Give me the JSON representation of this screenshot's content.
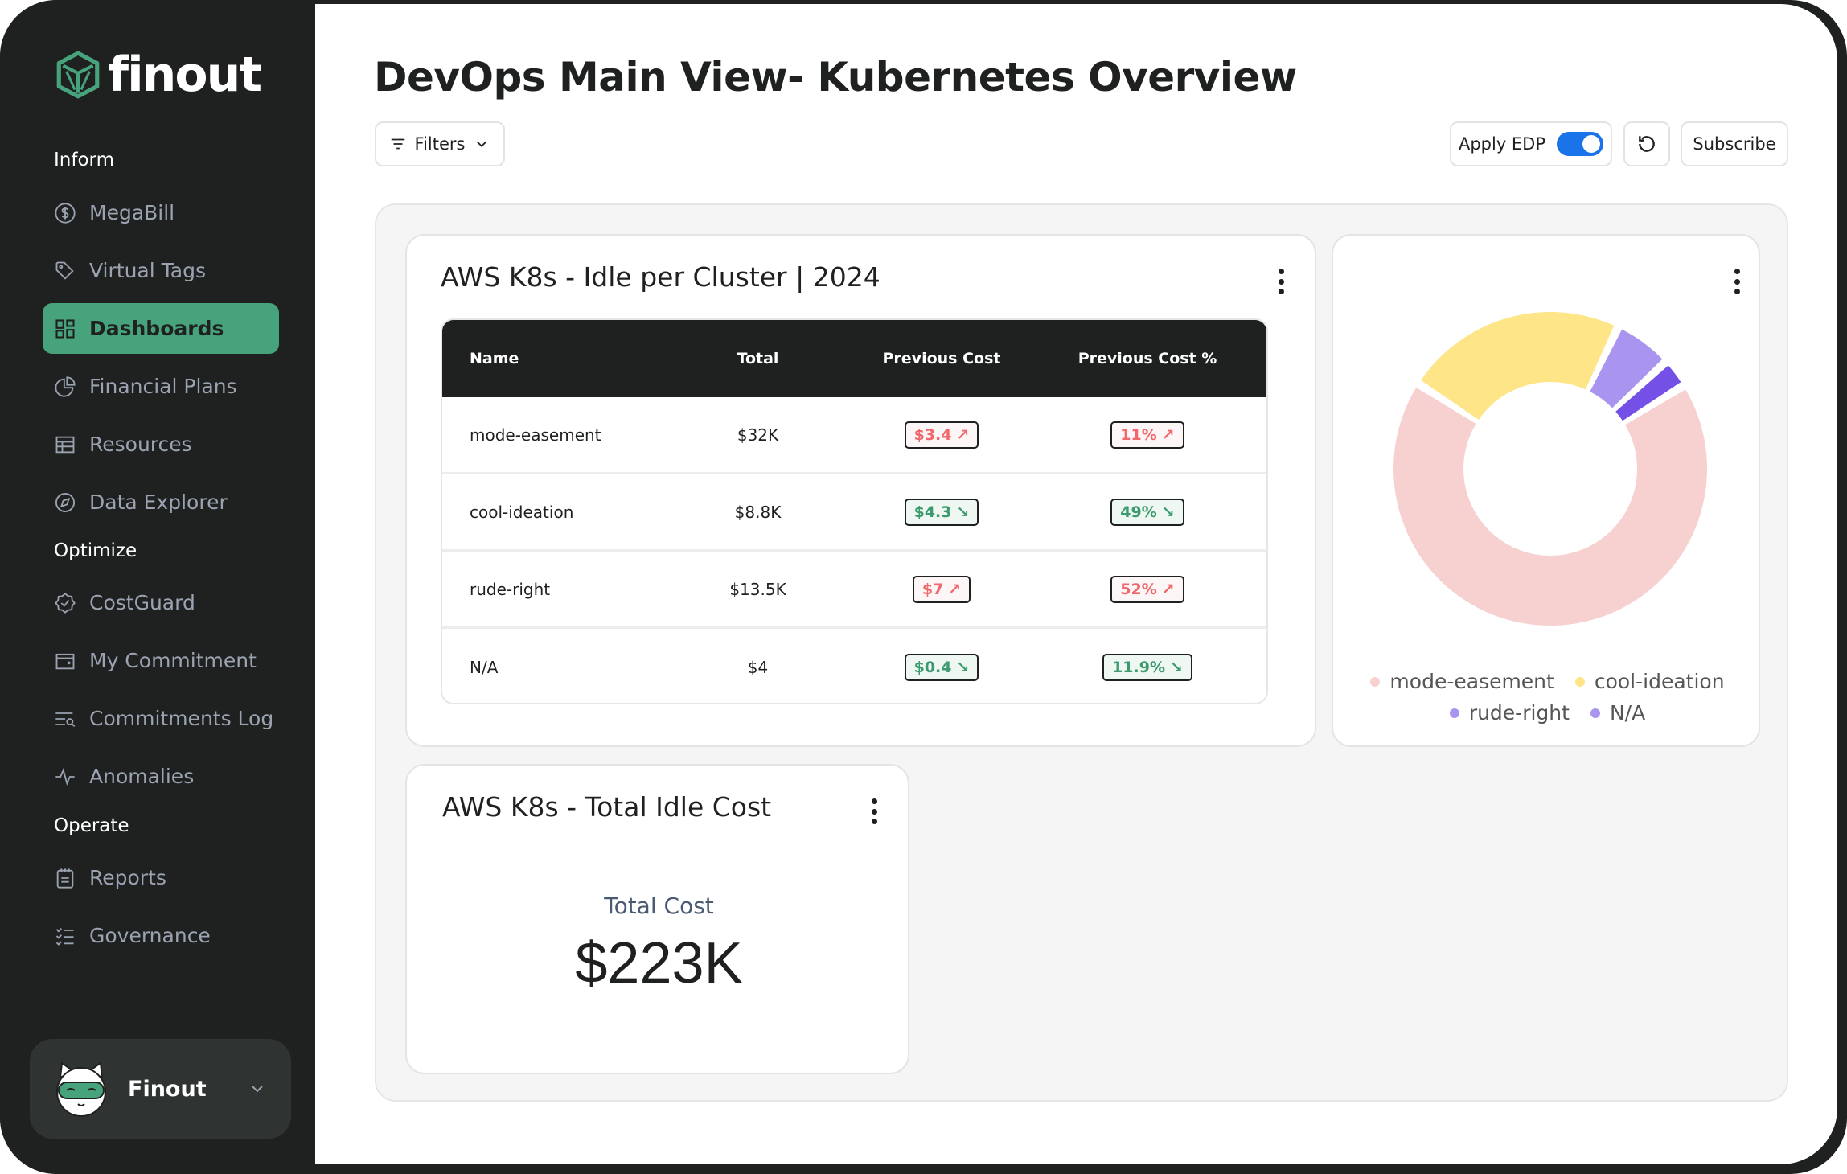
{
  "app": {
    "brand": "finout",
    "colors": {
      "accent": "#47a37b",
      "sidebar_bg": "#1e2120",
      "toggle_on": "#1a73e8",
      "up": "#f0676c",
      "down": "#3c9b6e"
    }
  },
  "sidebar": {
    "sections": [
      {
        "label": "Inform",
        "items": [
          {
            "label": "MegaBill",
            "icon": "dollar-circle-icon"
          },
          {
            "label": "Virtual Tags",
            "icon": "tag-icon"
          },
          {
            "label": "Dashboards",
            "icon": "dashboard-grid-icon",
            "active": true
          },
          {
            "label": "Financial Plans",
            "icon": "pie-chart-icon"
          },
          {
            "label": "Resources",
            "icon": "table-icon"
          },
          {
            "label": "Data Explorer",
            "icon": "compass-icon"
          }
        ]
      },
      {
        "label": "Optimize",
        "items": [
          {
            "label": "CostGuard",
            "icon": "badge-check-icon"
          },
          {
            "label": "My Commitment",
            "icon": "wallet-icon"
          },
          {
            "label": "Commitments Log",
            "icon": "list-search-icon"
          },
          {
            "label": "Anomalies",
            "icon": "pulse-icon"
          }
        ]
      },
      {
        "label": "Operate",
        "items": [
          {
            "label": "Reports",
            "icon": "clipboard-icon"
          },
          {
            "label": "Governance",
            "icon": "checklist-icon"
          }
        ]
      }
    ],
    "user": {
      "name": "Finout",
      "avatar": "cat-avatar-icon"
    }
  },
  "header": {
    "title": "DevOps Main View- Kubernetes Overview",
    "filters_label": "Filters",
    "apply_edp_label": "Apply EDP",
    "apply_edp_on": true,
    "subscribe_label": "Subscribe"
  },
  "widgets": {
    "idle_table": {
      "title": "AWS K8s - Idle per Cluster | 2024",
      "columns": [
        "Name",
        "Total",
        "Previous Cost",
        "Previous Cost %"
      ],
      "rows": [
        {
          "name": "mode-easement",
          "total": "$32K",
          "prev": "$3.4",
          "prev_pct": "11%",
          "trend": "up"
        },
        {
          "name": "cool-ideation",
          "total": "$8.8K",
          "prev": "$4.3",
          "prev_pct": "49%",
          "trend": "down"
        },
        {
          "name": "rude-right",
          "total": "$13.5K",
          "prev": "$7",
          "prev_pct": "52%",
          "trend": "up"
        },
        {
          "name": "N/A",
          "total": "$4",
          "prev": "$0.4",
          "prev_pct": "11.9%",
          "trend": "down"
        }
      ]
    },
    "total_idle": {
      "title": "AWS K8s - Total Idle Cost",
      "label": "Total Cost",
      "value": "$223K"
    }
  },
  "chart_data": {
    "type": "pie",
    "subtype": "donut",
    "title": "",
    "categories": [
      "mode-easement",
      "cool-ideation",
      "rude-right",
      "N/A"
    ],
    "values": [
      68,
      23,
      6,
      3
    ],
    "unit": "percent (estimated share)",
    "colors": [
      "#f7d0d0",
      "#fee587",
      "#a995f0",
      "#7450e6"
    ],
    "legend": {
      "position": "bottom",
      "entries": [
        {
          "label": "mode-easement",
          "color": "#f7d0d0"
        },
        {
          "label": "cool-ideation",
          "color": "#fee587"
        },
        {
          "label": "rude-right",
          "color": "#a995f0"
        },
        {
          "label": "N/A",
          "color": "#a995f0"
        }
      ]
    }
  }
}
